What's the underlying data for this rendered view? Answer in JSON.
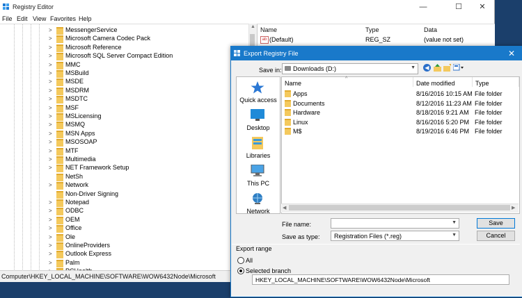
{
  "regedit": {
    "title": "Registry Editor",
    "window_controls": {
      "minimize": "—",
      "maximize": "☐",
      "close": "✕"
    },
    "menu": [
      "File",
      "Edit",
      "View",
      "Favorites",
      "Help"
    ],
    "tree": {
      "expander": ">",
      "items": [
        {
          "label": "MessengerService",
          "expandable": true
        },
        {
          "label": "Microsoft Camera Codec Pack",
          "expandable": true
        },
        {
          "label": "Microsoft Reference",
          "expandable": true
        },
        {
          "label": "Microsoft SQL Server Compact Edition",
          "expandable": true
        },
        {
          "label": "MMC",
          "expandable": true
        },
        {
          "label": "MSBuild",
          "expandable": true
        },
        {
          "label": "MSDE",
          "expandable": true
        },
        {
          "label": "MSDRM",
          "expandable": true
        },
        {
          "label": "MSDTC",
          "expandable": true
        },
        {
          "label": "MSF",
          "expandable": true
        },
        {
          "label": "MSLicensing",
          "expandable": true
        },
        {
          "label": "MSMQ",
          "expandable": true
        },
        {
          "label": "MSN Apps",
          "expandable": true
        },
        {
          "label": "MSOSOAP",
          "expandable": true
        },
        {
          "label": "MTF",
          "expandable": true
        },
        {
          "label": "Multimedia",
          "expandable": true
        },
        {
          "label": "NET Framework Setup",
          "expandable": true
        },
        {
          "label": "NetSh",
          "expandable": false
        },
        {
          "label": "Network",
          "expandable": true
        },
        {
          "label": "Non-Driver Signing",
          "expandable": false
        },
        {
          "label": "Notepad",
          "expandable": true
        },
        {
          "label": "ODBC",
          "expandable": true
        },
        {
          "label": "OEM",
          "expandable": true
        },
        {
          "label": "Office",
          "expandable": true
        },
        {
          "label": "Ole",
          "expandable": true
        },
        {
          "label": "OnlineProviders",
          "expandable": true
        },
        {
          "label": "Outlook Express",
          "expandable": true
        },
        {
          "label": "Palm",
          "expandable": true
        },
        {
          "label": "PCHealth",
          "expandable": true
        }
      ]
    },
    "list": {
      "columns": [
        "Name",
        "Type",
        "Data"
      ],
      "rows": [
        {
          "name": "(Default)",
          "type": "REG_SZ",
          "data": "(value not set)"
        }
      ]
    },
    "status_path": "Computer\\HKEY_LOCAL_MACHINE\\SOFTWARE\\WOW6432Node\\Microsoft"
  },
  "dialog": {
    "title": "Export Registry File",
    "close_glyph": "✕",
    "save_in_label": "Save in:",
    "save_in_value": "Downloads (D:)",
    "places": [
      "Quick access",
      "Desktop",
      "Libraries",
      "This PC",
      "Network"
    ],
    "columns": [
      "Name",
      "Date modified",
      "Type"
    ],
    "files": [
      {
        "name": "Apps",
        "date": "8/16/2016 10:15 AM",
        "type": "File folder"
      },
      {
        "name": "Documents",
        "date": "8/12/2016 11:23 AM",
        "type": "File folder"
      },
      {
        "name": "Hardware",
        "date": "8/18/2016 9:21 AM",
        "type": "File folder"
      },
      {
        "name": "Linux",
        "date": "8/16/2016 5:20 PM",
        "type": "File folder"
      },
      {
        "name": "M$",
        "date": "8/19/2016 6:46 PM",
        "type": "File folder"
      }
    ],
    "file_name_label": "File name:",
    "file_name_value": "",
    "save_as_type_label": "Save as type:",
    "save_as_type_value": "Registration Files (*.reg)",
    "save_button": "Save",
    "cancel_button": "Cancel",
    "export_range": {
      "label": "Export range",
      "all_label": "All",
      "selected_label": "Selected branch",
      "selected": "branch",
      "branch_value": "HKEY_LOCAL_MACHINE\\SOFTWARE\\WOW6432Node\\Microsoft"
    }
  },
  "colors": {
    "accent": "#1979ca",
    "folder": "#f4c95d",
    "desktop_bg": "#1b3f6b"
  }
}
